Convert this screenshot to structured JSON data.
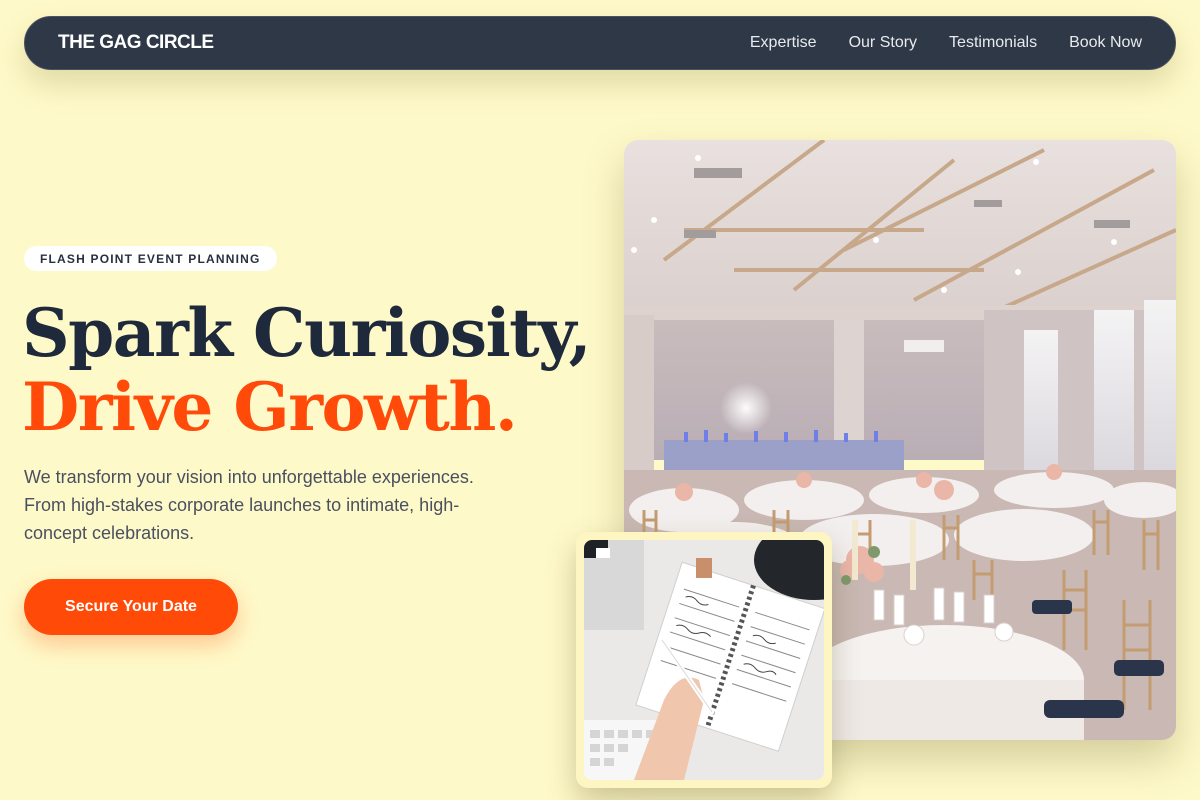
{
  "nav": {
    "brand": "THE GAG CIRCLE",
    "links": [
      "Expertise",
      "Our Story",
      "Testimonials",
      "Book Now"
    ]
  },
  "hero": {
    "badge": "FLASH POINT EVENT PLANNING",
    "headline_line1": "Spark Curiosity,",
    "headline_line2": "Drive Growth.",
    "description": "We transform your vision into unforgettable experiences. From high-stakes corporate launches to intimate, high-concept celebrations.",
    "cta_label": "Secure Your Date"
  },
  "colors": {
    "background": "#fef9c8",
    "nav_bg": "#2f3847",
    "accent": "#ff4a0a",
    "heading": "#1e293b"
  }
}
